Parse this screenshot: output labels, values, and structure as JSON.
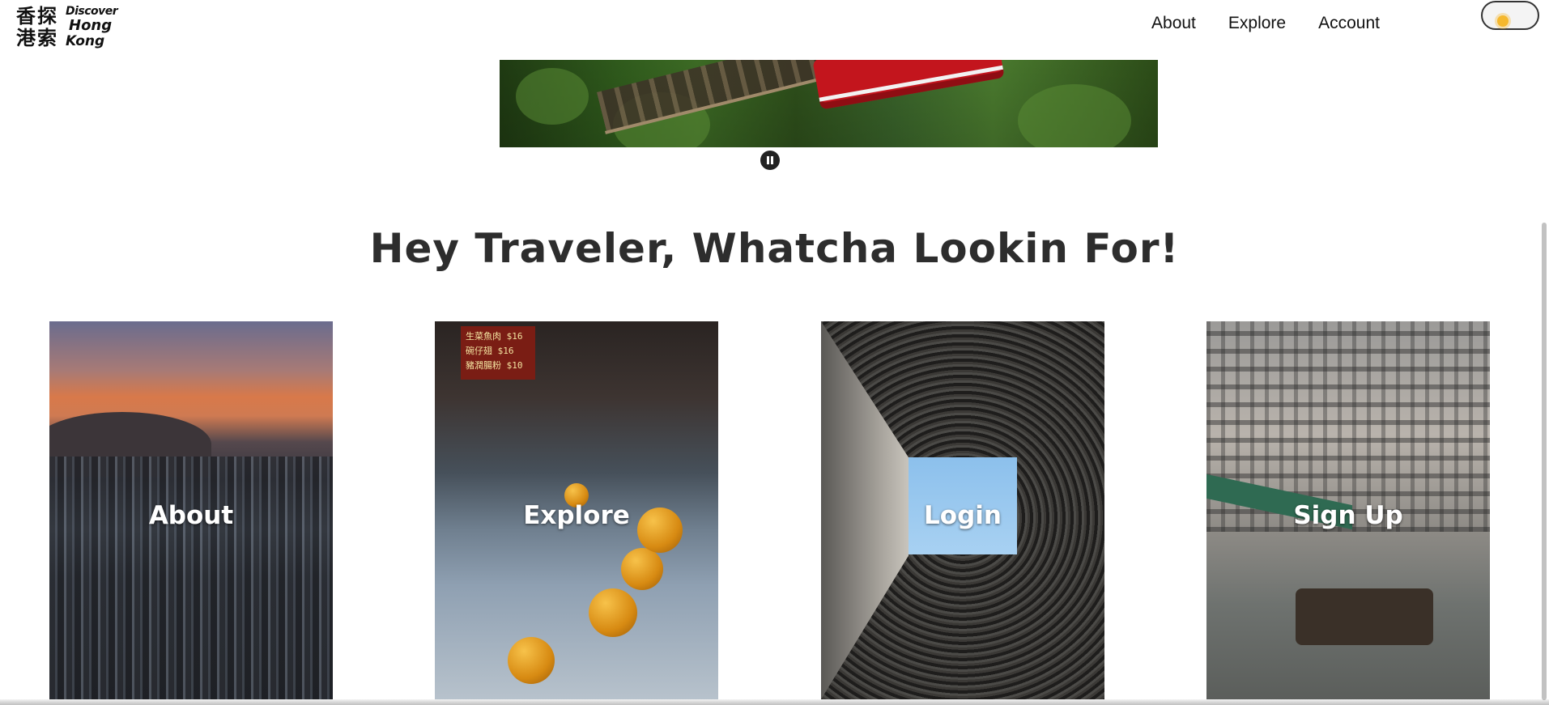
{
  "logo": {
    "cjk_line1": "香探",
    "cjk_line2": "港索",
    "en_line1": "Discover",
    "en_line2": "Hong",
    "en_line3": "Kong"
  },
  "nav": {
    "items": [
      {
        "label": "About"
      },
      {
        "label": "Explore"
      },
      {
        "label": "Account"
      }
    ]
  },
  "theme_toggle": {
    "icon": "sun-icon",
    "color": "#f5b82e"
  },
  "hero": {
    "pause_icon": "pause-icon",
    "sign_lines": [
      "生菜魚肉 $16",
      "碗仔翅 $16",
      "豬潤腸粉 $10"
    ]
  },
  "headline": "Hey Traveler, Whatcha Lookin For!",
  "cards": [
    {
      "label": "About"
    },
    {
      "label": "Explore"
    },
    {
      "label": "Login"
    },
    {
      "label": "Sign Up"
    }
  ]
}
